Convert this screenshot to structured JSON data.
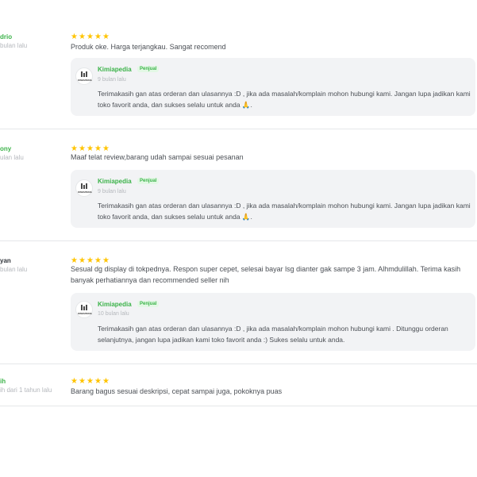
{
  "star_glyph": "★",
  "rating_color": "#ffc400",
  "brand_color": "#3cb34a",
  "reviews": [
    {
      "name": "drio",
      "time": "bulan lalu",
      "rating": 5,
      "text": "Produk oke. Harga terjangkau. Sangat recomend",
      "reply": {
        "shop": "Kimiapedia",
        "badge": "Penjual",
        "time": "9 bulan lalu",
        "text": "Terimakasih gan atas orderan dan ulasannya :D , jika ada masalah/komplain mohon hubungi kami. Jangan lupa jadikan kami toko favorit anda, dan sukses selalu untuk anda 🙏."
      }
    },
    {
      "name": "ony",
      "time": "ulan lalu",
      "rating": 5,
      "text": "Maaf telat review,barang udah sampai sesuai pesanan",
      "reply": {
        "shop": "Kimiapedia",
        "badge": "Penjual",
        "time": "9 bulan lalu",
        "text": "Terimakasih gan atas orderan dan ulasannya :D , jika ada masalah/komplain mohon hubungi kami. Jangan lupa jadikan kami toko favorit anda, dan sukses selalu untuk anda 🙏."
      }
    },
    {
      "name": "yan",
      "time": "bulan lalu",
      "rating": 5,
      "text": "Sesual dg display di tokpednya. Respon super cepet, selesai bayar lsg dianter gak sampe 3 jam. Alhmdulillah. Terima kasih banyak perhatiannya dan recommended seller nih",
      "reply": {
        "shop": "Kimiapedia",
        "badge": "Penjual",
        "time": "10 bulan lalu",
        "text": "Terimakasih gan atas orderan dan ulasannya :D , jika ada masalah/komplain mohon hubungi kami . Ditunggu orderan selanjutnya, jangan lupa jadikan kami toko favorit anda :) Sukes selalu untuk anda."
      }
    },
    {
      "name": "ih",
      "time": "ih dari 1 tahun lalu",
      "rating": 5,
      "text": "Barang bagus sesuai deskripsi, cepat sampai juga, pokoknya puas",
      "reply": null
    }
  ],
  "logo_text": "KIMIAPEDIA"
}
